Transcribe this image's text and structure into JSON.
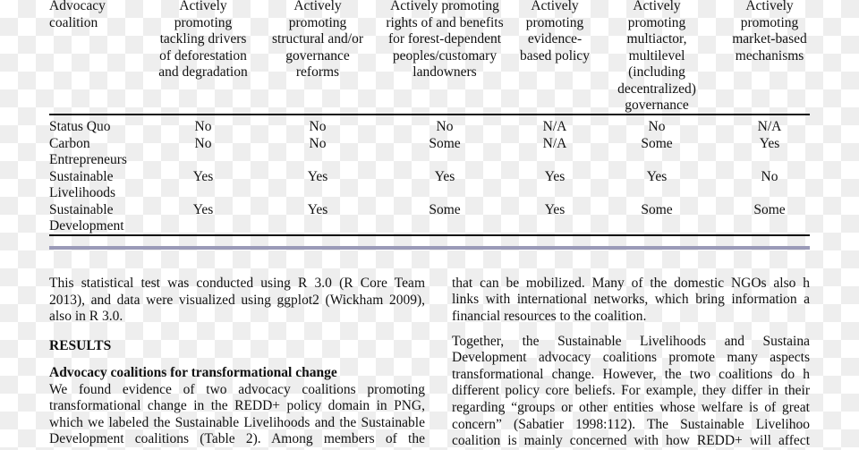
{
  "table": {
    "headers": [
      [
        "Advocacy",
        "coalition"
      ],
      [
        "Actively",
        "promoting",
        "tackling drivers",
        "of deforestation",
        "and degradation"
      ],
      [
        "Actively",
        "promoting",
        "structural and/or",
        "governance",
        "reforms"
      ],
      [
        "Actively promoting",
        "rights of and benefits",
        "for forest-dependent",
        "peoples/customary",
        "landowners"
      ],
      [
        "Actively",
        "promoting",
        "evidence-",
        "based policy"
      ],
      [
        "Actively",
        "promoting",
        "multiactor,",
        "multilevel",
        "(including",
        "decentralized)",
        "governance"
      ],
      [
        "Actively",
        "promoting",
        "market-based",
        "mechanisms"
      ]
    ],
    "rows": [
      {
        "name": [
          "Status Quo"
        ],
        "values": [
          "No",
          "No",
          "No",
          "N/A",
          "No",
          "N/A"
        ]
      },
      {
        "name": [
          "Carbon",
          "Entrepreneurs"
        ],
        "values": [
          "No",
          "No",
          "Some",
          "N/A",
          "Some",
          "Yes"
        ]
      },
      {
        "name": [
          "Sustainable",
          "Livelihoods"
        ],
        "values": [
          "Yes",
          "Yes",
          "Yes",
          "Yes",
          "Yes",
          "No"
        ]
      },
      {
        "name": [
          "Sustainable",
          "Development"
        ],
        "values": [
          "Yes",
          "Yes",
          "Some",
          "Yes",
          "Some",
          "Some"
        ]
      }
    ]
  },
  "left_column": {
    "para1": [
      "This statistical test was conducted using R 3.0 (R Core Team",
      "2013), and data were visualized using ggplot2 (Wickham 2009),",
      "also in R 3.0."
    ],
    "section_heading": "RESULTS",
    "subheading": "Advocacy coalitions for transformational change",
    "para2": [
      "We found evidence of two advocacy coalitions promoting",
      "transformational change in the REDD+ policy domain in PNG,",
      "which we labeled the Sustainable Livelihoods and the Sustainable",
      "Development coalitions (Table 2). Among members of the"
    ]
  },
  "right_column": {
    "para1": [
      "that can be mobilized. Many of the domestic NGOs also h",
      "links with international networks, which bring information a",
      "financial resources to the coalition."
    ],
    "para2": [
      "Together, the Sustainable Livelihoods and Sustaina",
      "Development advocacy coalitions promote many aspects",
      "transformational change. However, the two coalitions do h",
      "different policy core beliefs. For example, they differ in their beli",
      "regarding “groups or other entities whose welfare is of great",
      "concern” (Sabatier 1998:112). The Sustainable Livelihoo",
      "coalition is mainly concerned with how REDD+ will affect"
    ]
  },
  "colors": {
    "rule": "#111111",
    "divider": "#9a9ab8"
  }
}
